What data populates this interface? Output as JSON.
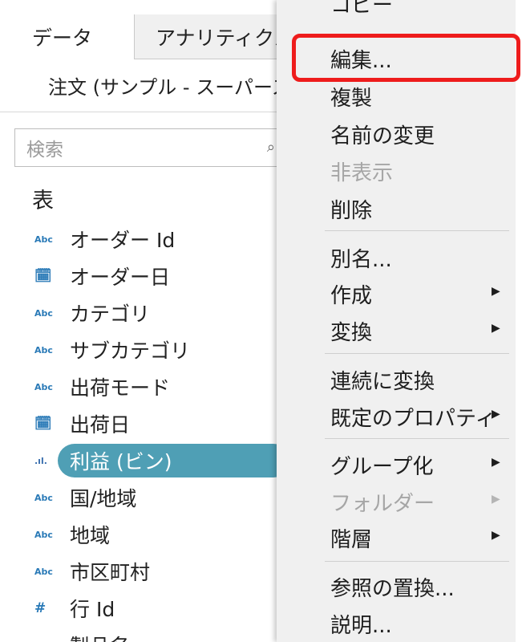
{
  "tabs": {
    "data": "データ",
    "analytics": "アナリティクス"
  },
  "data_source": {
    "name": "注文 (サンプル - スーパーストア)"
  },
  "search": {
    "placeholder": "検索"
  },
  "section_title": "表",
  "fields": [
    {
      "icon": "abc-icon",
      "glyph": "Abc",
      "name": "オーダー Id"
    },
    {
      "icon": "calendar-icon",
      "glyph": "🗓",
      "name": "オーダー日"
    },
    {
      "icon": "abc-icon",
      "glyph": "Abc",
      "name": "カテゴリ"
    },
    {
      "icon": "abc-icon",
      "glyph": "Abc",
      "name": "サブカテゴリ"
    },
    {
      "icon": "abc-icon",
      "glyph": "Abc",
      "name": "出荷モード"
    },
    {
      "icon": "calendar-icon",
      "glyph": "🗓",
      "name": "出荷日"
    },
    {
      "icon": "bin-icon",
      "glyph": ".ıl.",
      "name": "利益 (ビン)",
      "selected": true
    },
    {
      "icon": "abc-icon",
      "glyph": "Abc",
      "name": "国/地域"
    },
    {
      "icon": "abc-icon",
      "glyph": "Abc",
      "name": "地域"
    },
    {
      "icon": "abc-icon",
      "glyph": "Abc",
      "name": "市区町村"
    },
    {
      "icon": "number-icon",
      "glyph": "#",
      "name": "行 Id"
    },
    {
      "icon": "abc-icon",
      "glyph": "Abc",
      "name": "製品名"
    }
  ],
  "menu": {
    "copy": "コピー",
    "edit": "編集...",
    "duplicate": "複製",
    "rename": "名前の変更",
    "hide": "非表示",
    "delete": "削除",
    "alias": "別名...",
    "create": "作成",
    "convert": "変換",
    "to_continuous": "連続に変換",
    "default_properties": "既定のプロパティ",
    "group_by": "グループ化",
    "folder": "フォルダー",
    "hierarchy": "階層",
    "replace_references": "参照の置換...",
    "describe": "説明...",
    "submenu_arrow": "▶"
  },
  "colors": {
    "selected_pill": "#4f9fb5",
    "highlight": "#ee1c1c",
    "menu_bg": "#f0f0f0"
  }
}
